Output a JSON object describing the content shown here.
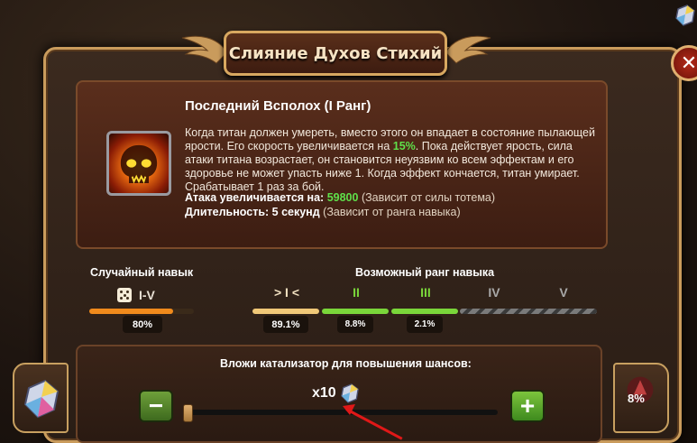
{
  "window": {
    "title": "Слияние Духов Стихий"
  },
  "skill": {
    "name": "Последний Всполох (I Ранг)",
    "desc_part1": "Когда титан должен умереть, вместо этого он впадает в состояние пылающей ярости. Его скорость увеличивается на ",
    "desc_speed": "15%",
    "desc_part2": ". Пока действует ярость, сила атаки титана возрастает, он становится неуязвим ко всем эффектам и его здоровье не может упасть ниже 1. Когда эффект кончается, титан умирает. Срабатывает 1 раз за бой.",
    "attack_label": "Атака увеличивается на:",
    "attack_value": "59800",
    "attack_note": "(Зависит от силы тотема)",
    "duration_label": "Длительность: 5 секунд",
    "duration_note": "(Зависит от ранга навыка)"
  },
  "random_skill": {
    "heading": "Случайный навык",
    "rank_range": "I-V",
    "chance_text": "80%",
    "chance": 0.8
  },
  "possible_rank": {
    "heading": "Возможный ранг навыка",
    "ranks": [
      {
        "label": "I",
        "chance_text": "89.1%",
        "chance": 0.891,
        "color": "#f0c878",
        "state": "current"
      },
      {
        "label": "II",
        "chance_text": "8.8%",
        "chance": 0.088,
        "color": "#7ad63a",
        "state": "possible"
      },
      {
        "label": "III",
        "chance_text": "2.1%",
        "chance": 0.021,
        "color": "#7ad63a",
        "state": "possible"
      },
      {
        "label": "IV",
        "chance_text": "",
        "color": "#9a9a9a",
        "state": "locked"
      },
      {
        "label": "V",
        "chance_text": "",
        "color": "#9a9a9a",
        "state": "locked"
      }
    ]
  },
  "catalyst": {
    "prompt": "Вложи катализатор для повышения шансов:",
    "multiplier": "x10",
    "slider_value": 0,
    "minus_label": "−",
    "plus_label": "+",
    "right_chance": "8%"
  },
  "colors": {
    "panel_border": "#c99b5c",
    "highlight_green": "#5fe04a",
    "bar_orange": "#f08a1c"
  }
}
